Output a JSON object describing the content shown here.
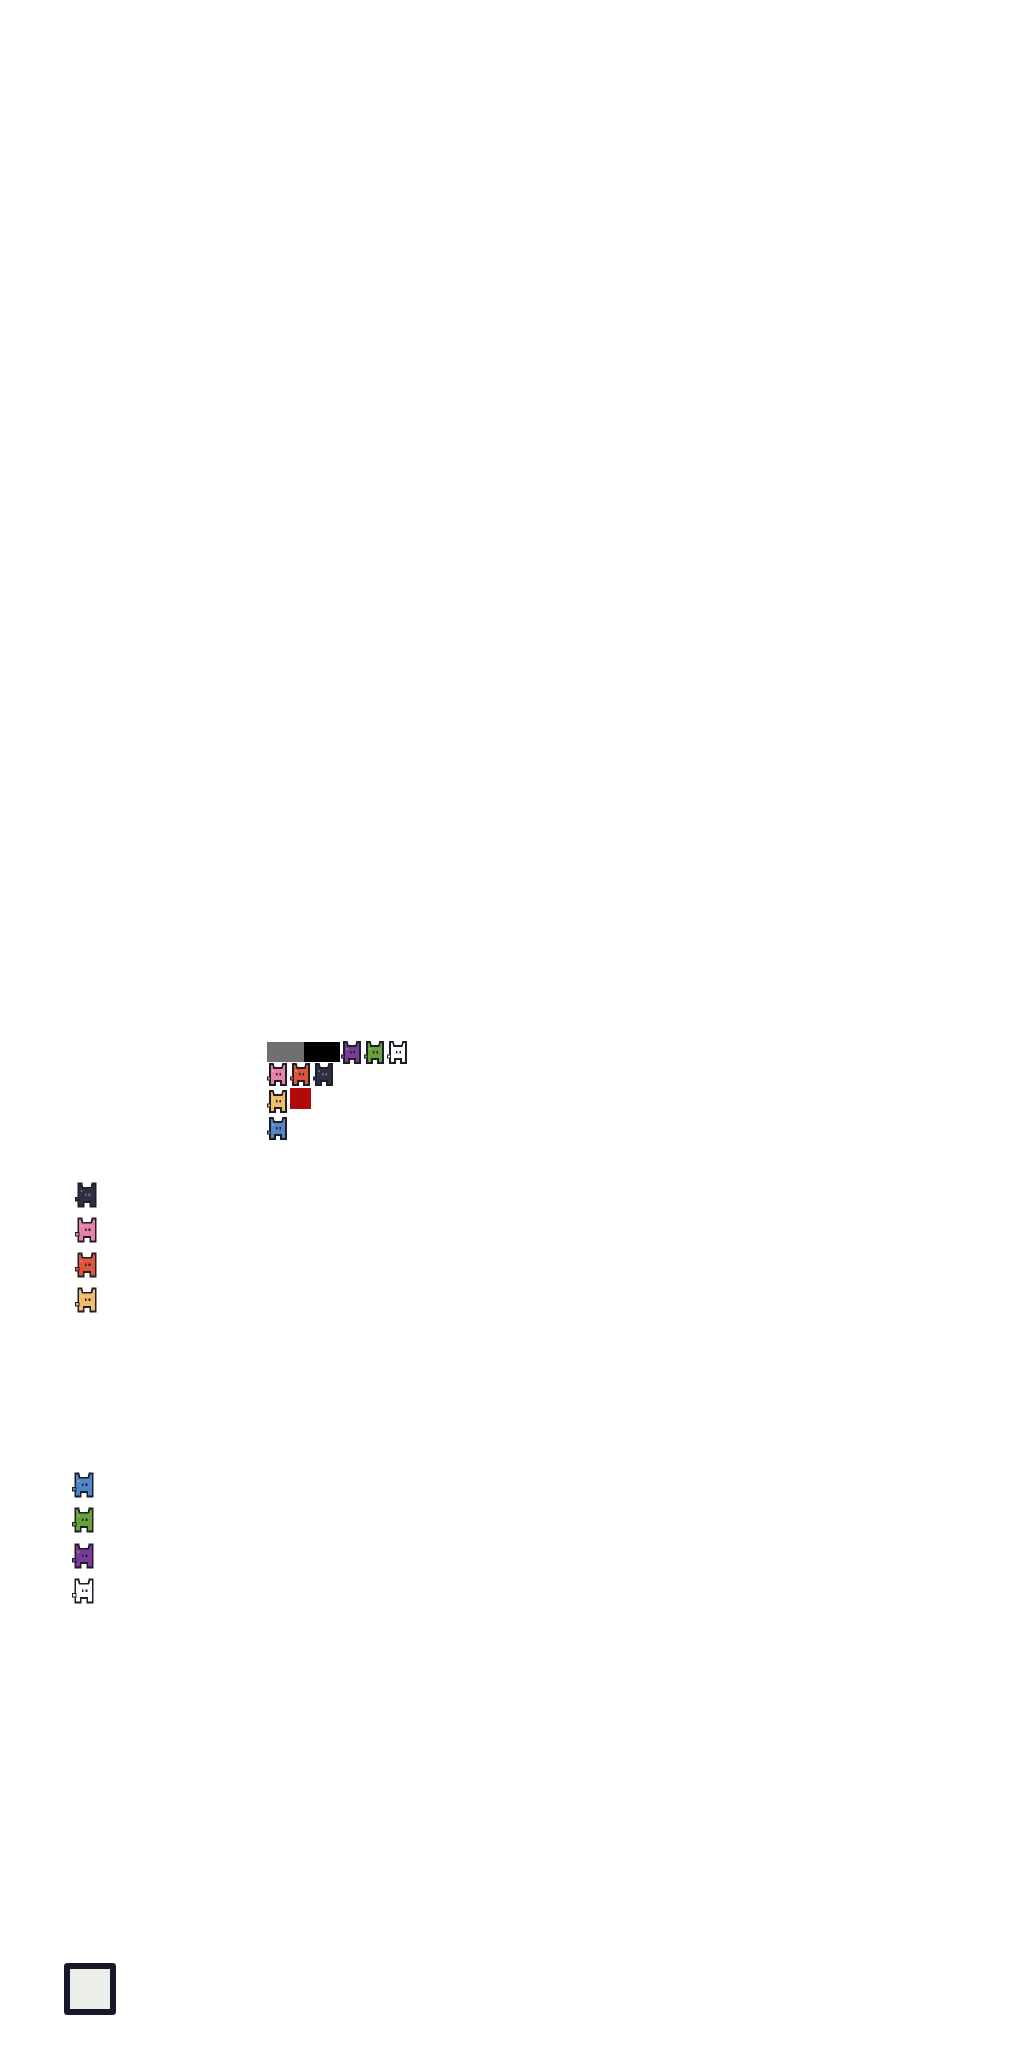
{
  "palette": {
    "swatches": [
      "#707070",
      "#000000",
      "#b00a0a"
    ]
  },
  "creature_colors": {
    "purple": "#7a3a96",
    "green": "#68a03c",
    "white": "#ffffff",
    "pink": "#e882a6",
    "orange": "#e0553a",
    "navy": "#2c3142",
    "yellow": "#f2bd6a",
    "blue": "#5586c4"
  },
  "sprite_icons": [
    "purple-creature-icon",
    "green-creature-icon",
    "white-creature-icon",
    "pink-creature-icon",
    "orange-creature-icon",
    "navy-creature-icon",
    "yellow-creature-icon",
    "blue-creature-icon"
  ],
  "left_column_upper": [
    "navy",
    "pink",
    "orange",
    "yellow"
  ],
  "left_column_lower": [
    "blue",
    "green",
    "purple",
    "white"
  ],
  "box": {
    "fill": "#eceee9",
    "border": "#16192a"
  }
}
